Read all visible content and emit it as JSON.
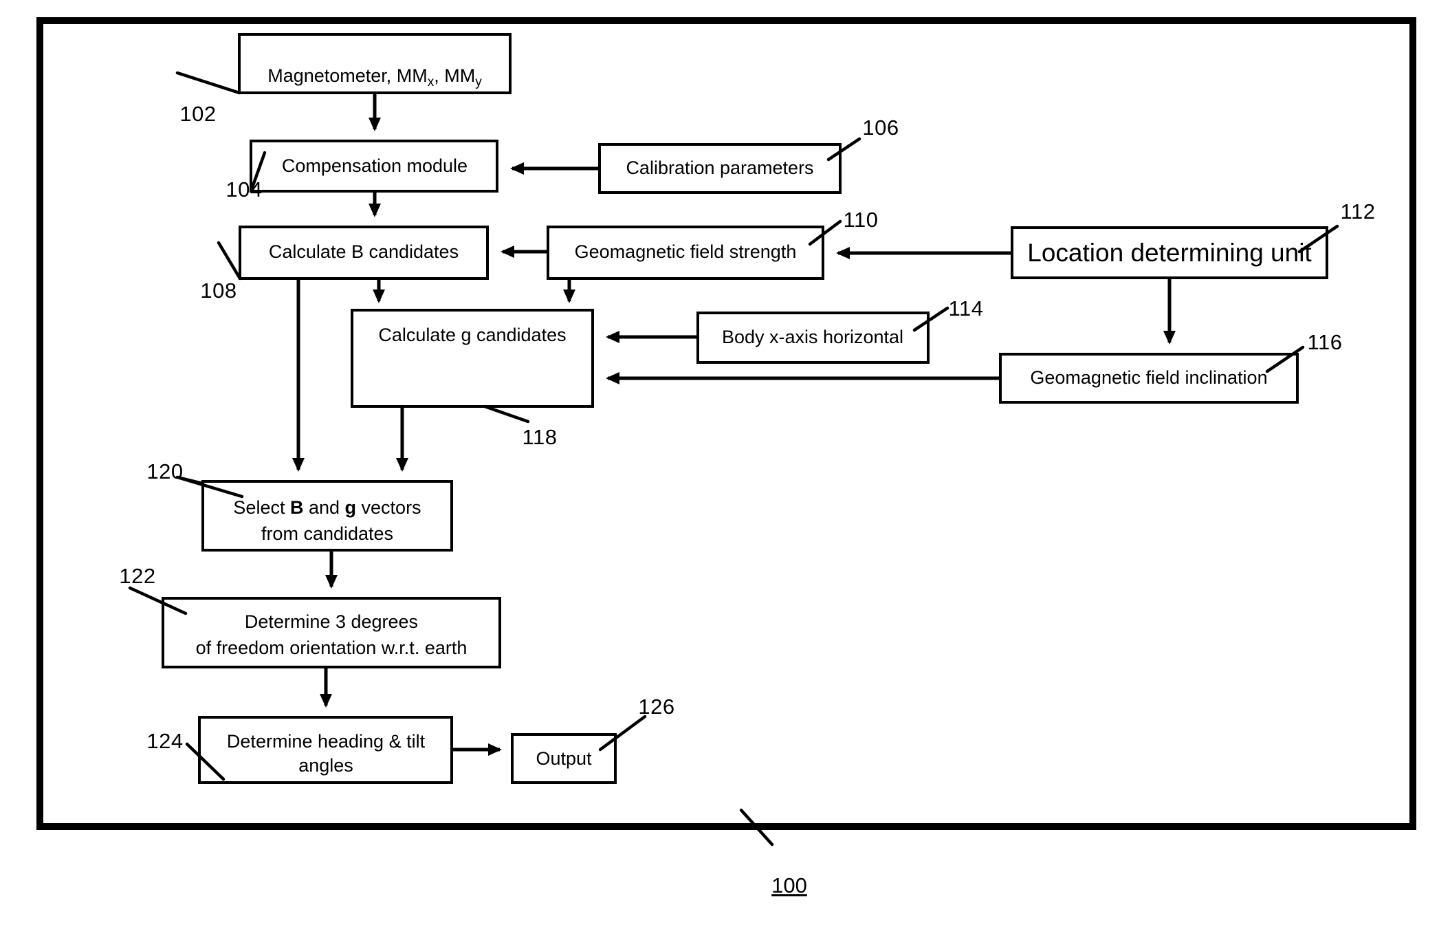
{
  "figure": {
    "number": "100",
    "type": "patent-flow-diagram"
  },
  "blocks": {
    "magnetometer": {
      "label_main": "Magnetometer, MM",
      "sub_x": "x",
      "label_mid": ", MM",
      "sub_y": "y",
      "ref": "102"
    },
    "compensation": {
      "label": "Compensation module",
      "ref": "104"
    },
    "calibration": {
      "label": "Calibration parameters",
      "ref": "106"
    },
    "calc_b": {
      "label": "Calculate B candidates",
      "ref": "108"
    },
    "geo_strength": {
      "label": "Geomagnetic field strength",
      "ref": "110"
    },
    "location_unit": {
      "label": "Location determining unit",
      "ref": "112"
    },
    "calc_g": {
      "label": "Calculate g candidates",
      "ref": "118"
    },
    "body_x": {
      "label": "Body x-axis horizontal",
      "ref": "114"
    },
    "geo_inclination": {
      "label": "Geomagnetic field inclination",
      "ref": "116"
    },
    "select_vectors": {
      "line1_pre": "Select ",
      "line1_b": "B",
      "line1_mid": " and ",
      "line1_g": "g",
      "line1_post": " vectors",
      "line2": "from candidates",
      "ref": "120"
    },
    "determine_3dof": {
      "line1": "Determine 3 degrees",
      "line2": "of freedom orientation w.r.t. earth",
      "ref": "122"
    },
    "determine_heading": {
      "line1": "Determine heading & tilt",
      "line2": "angles",
      "ref": "124"
    },
    "output": {
      "label": "Output",
      "ref": "126"
    }
  },
  "colors": {
    "ink": "#000000",
    "paper": "#ffffff"
  }
}
